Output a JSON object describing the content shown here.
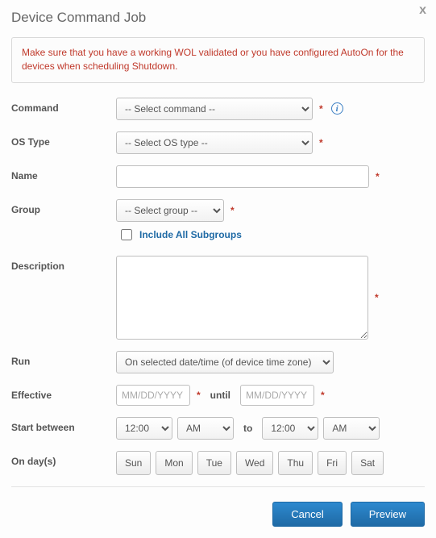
{
  "dialog": {
    "title": "Device Command Job",
    "close": "x",
    "alert": "Make sure that you have a working WOL validated or you have configured AutoOn for the devices when scheduling Shutdown."
  },
  "labels": {
    "command": "Command",
    "os_type": "OS Type",
    "name": "Name",
    "group": "Group",
    "include_subgroups": "Include All Subgroups",
    "description": "Description",
    "run": "Run",
    "effective": "Effective",
    "until": "until",
    "start_between": "Start between",
    "to": "to",
    "on_days": "On day(s)"
  },
  "fields": {
    "command_placeholder": "-- Select command --",
    "os_type_placeholder": "-- Select OS type --",
    "name_value": "",
    "group_placeholder": "-- Select group --",
    "include_subgroups_checked": false,
    "description_value": "",
    "run_value": "On selected date/time (of device time zone)",
    "effective_from_placeholder": "MM/DD/YYYY",
    "effective_until_placeholder": "MM/DD/YYYY",
    "start_hr_from": "12:00",
    "start_ampm_from": "AM",
    "start_hr_to": "12:00",
    "start_ampm_to": "AM"
  },
  "days": [
    "Sun",
    "Mon",
    "Tue",
    "Wed",
    "Thu",
    "Fri",
    "Sat"
  ],
  "footer": {
    "cancel": "Cancel",
    "preview": "Preview"
  },
  "marks": {
    "required": "*",
    "info": "i"
  }
}
